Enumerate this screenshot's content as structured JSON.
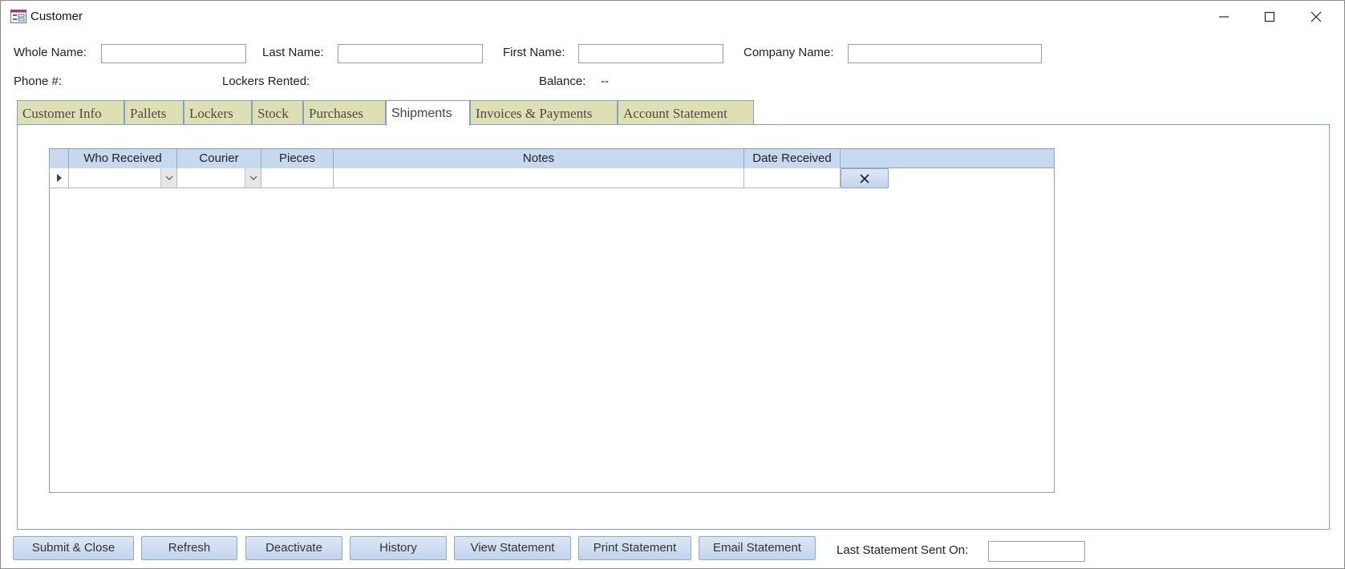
{
  "window": {
    "title": "Customer",
    "icon": "form-icon"
  },
  "header": {
    "whole_name_label": "Whole Name:",
    "whole_name_value": "",
    "last_name_label": "Last Name:",
    "last_name_value": "",
    "first_name_label": "First Name:",
    "first_name_value": "",
    "company_name_label": "Company Name:",
    "company_name_value": "",
    "phone_label": "Phone #:",
    "lockers_rented_label": "Lockers Rented:",
    "balance_label": "Balance:",
    "balance_value": "--"
  },
  "tabs": [
    {
      "label": "Customer Info"
    },
    {
      "label": "Pallets"
    },
    {
      "label": "Lockers"
    },
    {
      "label": "Stock"
    },
    {
      "label": "Purchases"
    },
    {
      "label": "Shipments",
      "active": true
    },
    {
      "label": "Invoices & Payments"
    },
    {
      "label": "Account Statement"
    }
  ],
  "grid": {
    "columns": [
      "Who Received",
      "Courier",
      "Pieces",
      "Notes",
      "Date Received"
    ],
    "new_row": {
      "who_received": "",
      "courier": "",
      "pieces": "",
      "notes": "",
      "date_received": ""
    }
  },
  "footer": {
    "buttons": [
      "Submit & Close",
      "Refresh",
      "Deactivate",
      "History",
      "View Statement",
      "Print Statement",
      "Email Statement"
    ],
    "last_statement_label": "Last Statement Sent On:",
    "last_statement_value": ""
  },
  "colors": {
    "tab_inactive": "#dfdfb4",
    "tab_border": "#7da2ce",
    "grid_header": "#c6d9f0",
    "button_face": "#c2d4ec"
  }
}
